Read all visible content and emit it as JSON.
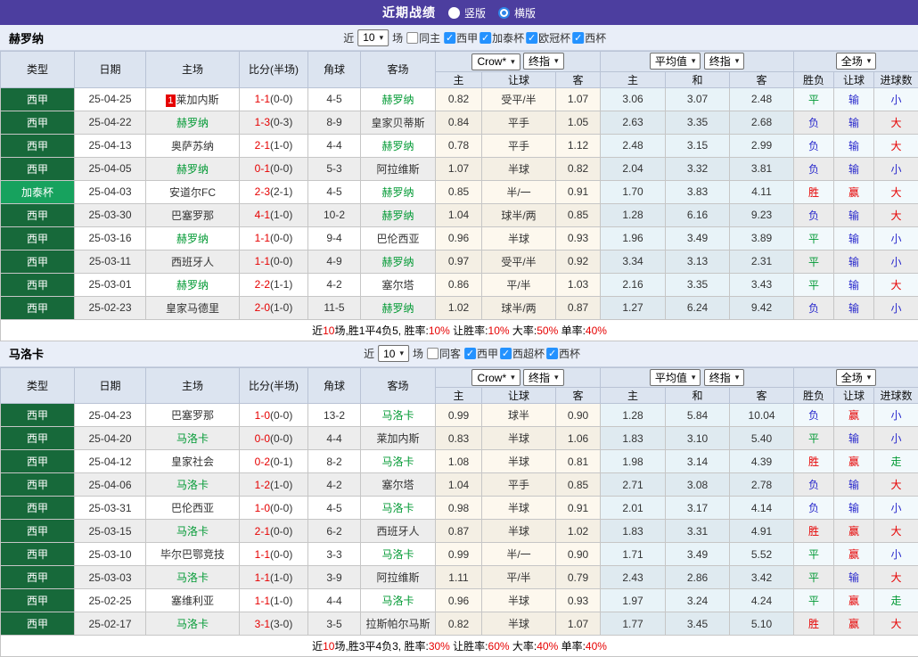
{
  "titlebar": {
    "title": "近期战绩",
    "radio_vertical": "竖版",
    "radio_horizontal": "横版",
    "selected": "横版"
  },
  "colors": {
    "topbar_bg": "#4c3e9f",
    "league_dark_green": "#17693a",
    "league_light_green": "#17a25e",
    "team_green": "#009933",
    "score_red": "#e60000",
    "win_red": "#e60000",
    "draw_green": "#019934",
    "lose_blue": "#2828cc",
    "checkbox_blue": "#2492ff"
  },
  "table_header": {
    "cols": [
      "类型",
      "日期",
      "主场",
      "比分(半场)",
      "角球",
      "客场"
    ],
    "selects": {
      "crow": "Crow*",
      "crow2": "终指",
      "avg": "平均值",
      "avg2": "终指",
      "full": "全场"
    },
    "sub": [
      "主",
      "让球",
      "客",
      "主",
      "和",
      "客",
      "胜负",
      "让球",
      "进球数"
    ]
  },
  "sections": [
    {
      "team": "赫罗纳",
      "filter": {
        "prefix": "近",
        "count": "10",
        "suffix": "场",
        "same": "同主",
        "leagues": [
          "西甲",
          "加泰杯",
          "欧冠杯",
          "西杯"
        ]
      },
      "rows": [
        {
          "league": "西甲",
          "light": false,
          "date": "25-04-25",
          "badge": "1",
          "home": "莱加内斯",
          "home_team": false,
          "score": "1-1",
          "half": "(0-0)",
          "corner": "4-5",
          "away": "赫罗纳",
          "away_team": true,
          "crow": [
            "0.82",
            "受平/半",
            "1.07"
          ],
          "avg": [
            "3.06",
            "3.07",
            "2.48"
          ],
          "full": [
            [
              "平",
              "g"
            ],
            [
              "输",
              "b"
            ],
            [
              "小",
              "b"
            ]
          ]
        },
        {
          "league": "西甲",
          "light": false,
          "date": "25-04-22",
          "badge": "",
          "home": "赫罗纳",
          "home_team": true,
          "score": "1-3",
          "half": "(0-3)",
          "corner": "8-9",
          "away": "皇家贝蒂斯",
          "away_team": false,
          "crow": [
            "0.84",
            "平手",
            "1.05"
          ],
          "avg": [
            "2.63",
            "3.35",
            "2.68"
          ],
          "full": [
            [
              "负",
              "b"
            ],
            [
              "输",
              "b"
            ],
            [
              "大",
              "r"
            ]
          ]
        },
        {
          "league": "西甲",
          "light": false,
          "date": "25-04-13",
          "badge": "",
          "home": "奥萨苏纳",
          "home_team": false,
          "score": "2-1",
          "half": "(1-0)",
          "corner": "4-4",
          "away": "赫罗纳",
          "away_team": true,
          "crow": [
            "0.78",
            "平手",
            "1.12"
          ],
          "avg": [
            "2.48",
            "3.15",
            "2.99"
          ],
          "full": [
            [
              "负",
              "b"
            ],
            [
              "输",
              "b"
            ],
            [
              "大",
              "r"
            ]
          ]
        },
        {
          "league": "西甲",
          "light": false,
          "date": "25-04-05",
          "badge": "",
          "home": "赫罗纳",
          "home_team": true,
          "score": "0-1",
          "half": "(0-0)",
          "corner": "5-3",
          "away": "阿拉维斯",
          "away_team": false,
          "crow": [
            "1.07",
            "半球",
            "0.82"
          ],
          "avg": [
            "2.04",
            "3.32",
            "3.81"
          ],
          "full": [
            [
              "负",
              "b"
            ],
            [
              "输",
              "b"
            ],
            [
              "小",
              "b"
            ]
          ]
        },
        {
          "league": "加泰杯",
          "light": true,
          "date": "25-04-03",
          "badge": "",
          "home": "安道尔FC",
          "home_team": false,
          "score": "2-3",
          "half": "(2-1)",
          "corner": "4-5",
          "away": "赫罗纳",
          "away_team": true,
          "crow": [
            "0.85",
            "半/一",
            "0.91"
          ],
          "avg": [
            "1.70",
            "3.83",
            "4.11"
          ],
          "full": [
            [
              "胜",
              "r"
            ],
            [
              "赢",
              "r"
            ],
            [
              "大",
              "r"
            ]
          ]
        },
        {
          "league": "西甲",
          "light": false,
          "date": "25-03-30",
          "badge": "",
          "home": "巴塞罗那",
          "home_team": false,
          "score": "4-1",
          "half": "(1-0)",
          "corner": "10-2",
          "away": "赫罗纳",
          "away_team": true,
          "crow": [
            "1.04",
            "球半/两",
            "0.85"
          ],
          "avg": [
            "1.28",
            "6.16",
            "9.23"
          ],
          "full": [
            [
              "负",
              "b"
            ],
            [
              "输",
              "b"
            ],
            [
              "大",
              "r"
            ]
          ]
        },
        {
          "league": "西甲",
          "light": false,
          "date": "25-03-16",
          "badge": "",
          "home": "赫罗纳",
          "home_team": true,
          "score": "1-1",
          "half": "(0-0)",
          "corner": "9-4",
          "away": "巴伦西亚",
          "away_team": false,
          "crow": [
            "0.96",
            "半球",
            "0.93"
          ],
          "avg": [
            "1.96",
            "3.49",
            "3.89"
          ],
          "full": [
            [
              "平",
              "g"
            ],
            [
              "输",
              "b"
            ],
            [
              "小",
              "b"
            ]
          ]
        },
        {
          "league": "西甲",
          "light": false,
          "date": "25-03-11",
          "badge": "",
          "home": "西班牙人",
          "home_team": false,
          "score": "1-1",
          "half": "(0-0)",
          "corner": "4-9",
          "away": "赫罗纳",
          "away_team": true,
          "crow": [
            "0.97",
            "受平/半",
            "0.92"
          ],
          "avg": [
            "3.34",
            "3.13",
            "2.31"
          ],
          "full": [
            [
              "平",
              "g"
            ],
            [
              "输",
              "b"
            ],
            [
              "小",
              "b"
            ]
          ]
        },
        {
          "league": "西甲",
          "light": false,
          "date": "25-03-01",
          "badge": "",
          "home": "赫罗纳",
          "home_team": true,
          "score": "2-2",
          "half": "(1-1)",
          "corner": "4-2",
          "away": "塞尔塔",
          "away_team": false,
          "crow": [
            "0.86",
            "平/半",
            "1.03"
          ],
          "avg": [
            "2.16",
            "3.35",
            "3.43"
          ],
          "full": [
            [
              "平",
              "g"
            ],
            [
              "输",
              "b"
            ],
            [
              "大",
              "r"
            ]
          ]
        },
        {
          "league": "西甲",
          "light": false,
          "date": "25-02-23",
          "badge": "",
          "home": "皇家马德里",
          "home_team": false,
          "score": "2-0",
          "half": "(1-0)",
          "corner": "11-5",
          "away": "赫罗纳",
          "away_team": true,
          "crow": [
            "1.02",
            "球半/两",
            "0.87"
          ],
          "avg": [
            "1.27",
            "6.24",
            "9.42"
          ],
          "full": [
            [
              "负",
              "b"
            ],
            [
              "输",
              "b"
            ],
            [
              "小",
              "b"
            ]
          ]
        }
      ],
      "summary": [
        [
          "近",
          0
        ],
        [
          "10",
          1
        ],
        [
          "场,胜1平4负5, 胜率:",
          0
        ],
        [
          "10%",
          1
        ],
        [
          " 让胜率:",
          0
        ],
        [
          "10%",
          1
        ],
        [
          " 大率:",
          0
        ],
        [
          "50%",
          1
        ],
        [
          " 单率:",
          0
        ],
        [
          "40%",
          1
        ]
      ]
    },
    {
      "team": "马洛卡",
      "filter": {
        "prefix": "近",
        "count": "10",
        "suffix": "场",
        "same": "同客",
        "leagues": [
          "西甲",
          "西超杯",
          "西杯"
        ]
      },
      "rows": [
        {
          "league": "西甲",
          "light": false,
          "date": "25-04-23",
          "badge": "",
          "home": "巴塞罗那",
          "home_team": false,
          "score": "1-0",
          "half": "(0-0)",
          "corner": "13-2",
          "away": "马洛卡",
          "away_team": true,
          "crow": [
            "0.99",
            "球半",
            "0.90"
          ],
          "avg": [
            "1.28",
            "5.84",
            "10.04"
          ],
          "full": [
            [
              "负",
              "b"
            ],
            [
              "赢",
              "r"
            ],
            [
              "小",
              "b"
            ]
          ]
        },
        {
          "league": "西甲",
          "light": false,
          "date": "25-04-20",
          "badge": "",
          "home": "马洛卡",
          "home_team": true,
          "score": "0-0",
          "half": "(0-0)",
          "corner": "4-4",
          "away": "莱加内斯",
          "away_team": false,
          "crow": [
            "0.83",
            "半球",
            "1.06"
          ],
          "avg": [
            "1.83",
            "3.10",
            "5.40"
          ],
          "full": [
            [
              "平",
              "g"
            ],
            [
              "输",
              "b"
            ],
            [
              "小",
              "b"
            ]
          ]
        },
        {
          "league": "西甲",
          "light": false,
          "date": "25-04-12",
          "badge": "",
          "home": "皇家社会",
          "home_team": false,
          "score": "0-2",
          "half": "(0-1)",
          "corner": "8-2",
          "away": "马洛卡",
          "away_team": true,
          "crow": [
            "1.08",
            "半球",
            "0.81"
          ],
          "avg": [
            "1.98",
            "3.14",
            "4.39"
          ],
          "full": [
            [
              "胜",
              "r"
            ],
            [
              "赢",
              "r"
            ],
            [
              "走",
              "g"
            ]
          ]
        },
        {
          "league": "西甲",
          "light": false,
          "date": "25-04-06",
          "badge": "",
          "home": "马洛卡",
          "home_team": true,
          "score": "1-2",
          "half": "(1-0)",
          "corner": "4-2",
          "away": "塞尔塔",
          "away_team": false,
          "crow": [
            "1.04",
            "平手",
            "0.85"
          ],
          "avg": [
            "2.71",
            "3.08",
            "2.78"
          ],
          "full": [
            [
              "负",
              "b"
            ],
            [
              "输",
              "b"
            ],
            [
              "大",
              "r"
            ]
          ]
        },
        {
          "league": "西甲",
          "light": false,
          "date": "25-03-31",
          "badge": "",
          "home": "巴伦西亚",
          "home_team": false,
          "score": "1-0",
          "half": "(0-0)",
          "corner": "4-5",
          "away": "马洛卡",
          "away_team": true,
          "crow": [
            "0.98",
            "半球",
            "0.91"
          ],
          "avg": [
            "2.01",
            "3.17",
            "4.14"
          ],
          "full": [
            [
              "负",
              "b"
            ],
            [
              "输",
              "b"
            ],
            [
              "小",
              "b"
            ]
          ]
        },
        {
          "league": "西甲",
          "light": false,
          "date": "25-03-15",
          "badge": "",
          "home": "马洛卡",
          "home_team": true,
          "score": "2-1",
          "half": "(0-0)",
          "corner": "6-2",
          "away": "西班牙人",
          "away_team": false,
          "crow": [
            "0.87",
            "半球",
            "1.02"
          ],
          "avg": [
            "1.83",
            "3.31",
            "4.91"
          ],
          "full": [
            [
              "胜",
              "r"
            ],
            [
              "赢",
              "r"
            ],
            [
              "大",
              "r"
            ]
          ]
        },
        {
          "league": "西甲",
          "light": false,
          "date": "25-03-10",
          "badge": "",
          "home": "毕尔巴鄂竞技",
          "home_team": false,
          "score": "1-1",
          "half": "(0-0)",
          "corner": "3-3",
          "away": "马洛卡",
          "away_team": true,
          "crow": [
            "0.99",
            "半/一",
            "0.90"
          ],
          "avg": [
            "1.71",
            "3.49",
            "5.52"
          ],
          "full": [
            [
              "平",
              "g"
            ],
            [
              "赢",
              "r"
            ],
            [
              "小",
              "b"
            ]
          ]
        },
        {
          "league": "西甲",
          "light": false,
          "date": "25-03-03",
          "badge": "",
          "home": "马洛卡",
          "home_team": true,
          "score": "1-1",
          "half": "(1-0)",
          "corner": "3-9",
          "away": "阿拉维斯",
          "away_team": false,
          "crow": [
            "1.11",
            "平/半",
            "0.79"
          ],
          "avg": [
            "2.43",
            "2.86",
            "3.42"
          ],
          "full": [
            [
              "平",
              "g"
            ],
            [
              "输",
              "b"
            ],
            [
              "大",
              "r"
            ]
          ]
        },
        {
          "league": "西甲",
          "light": false,
          "date": "25-02-25",
          "badge": "",
          "home": "塞维利亚",
          "home_team": false,
          "score": "1-1",
          "half": "(1-0)",
          "corner": "4-4",
          "away": "马洛卡",
          "away_team": true,
          "crow": [
            "0.96",
            "半球",
            "0.93"
          ],
          "avg": [
            "1.97",
            "3.24",
            "4.24"
          ],
          "full": [
            [
              "平",
              "g"
            ],
            [
              "赢",
              "r"
            ],
            [
              "走",
              "g"
            ]
          ]
        },
        {
          "league": "西甲",
          "light": false,
          "date": "25-02-17",
          "badge": "",
          "home": "马洛卡",
          "home_team": true,
          "score": "3-1",
          "half": "(3-0)",
          "corner": "3-5",
          "away": "拉斯帕尔马斯",
          "away_team": false,
          "crow": [
            "0.82",
            "半球",
            "1.07"
          ],
          "avg": [
            "1.77",
            "3.45",
            "5.10"
          ],
          "full": [
            [
              "胜",
              "r"
            ],
            [
              "赢",
              "r"
            ],
            [
              "大",
              "r"
            ]
          ]
        }
      ],
      "summary": [
        [
          "近",
          0
        ],
        [
          "10",
          1
        ],
        [
          "场,胜3平4负3, 胜率:",
          0
        ],
        [
          "30%",
          1
        ],
        [
          " 让胜率:",
          0
        ],
        [
          "60%",
          1
        ],
        [
          " 大率:",
          0
        ],
        [
          "40%",
          1
        ],
        [
          " 单率:",
          0
        ],
        [
          "40%",
          1
        ]
      ]
    }
  ]
}
